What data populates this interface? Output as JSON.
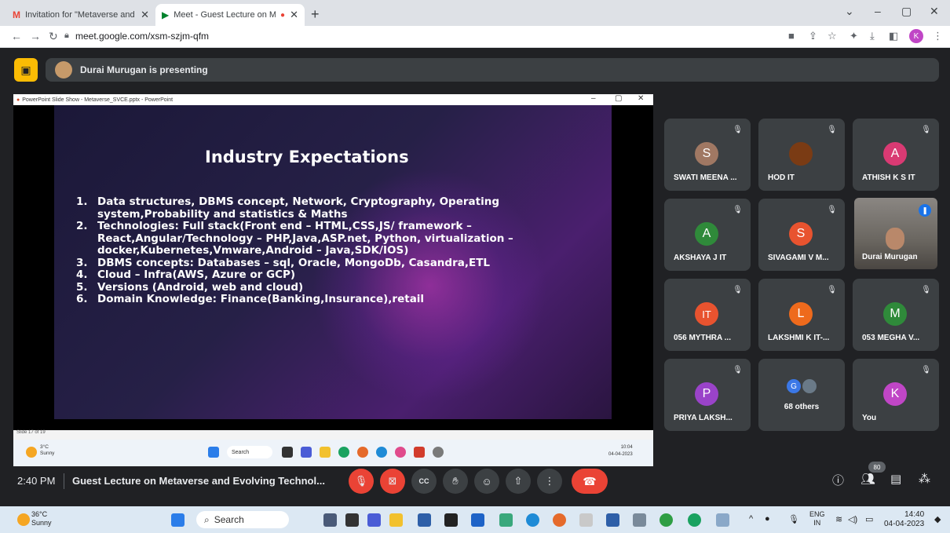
{
  "browser": {
    "tabs": [
      {
        "label": "Invitation for \"Metaverse and Evo"
      },
      {
        "label": "Meet - Guest Lecture on Me"
      }
    ],
    "url": "meet.google.com/xsm-szjm-qfm",
    "profile_initial": "K"
  },
  "meet": {
    "presenter_banner": "Durai Murugan is presenting",
    "time": "2:40 PM",
    "meeting_title": "Guest Lecture on Metaverse and Evolving Technol...",
    "participant_count": "80",
    "participants": [
      {
        "initial": "S",
        "name": "SWATI MEENA ...",
        "color": "#a07863"
      },
      {
        "initial": "",
        "name": "HOD IT",
        "color": "#7a3b14"
      },
      {
        "initial": "A",
        "name": "ATHISH K S IT",
        "color": "#d93a73"
      },
      {
        "initial": "A",
        "name": "AKSHAYA J IT",
        "color": "#2f8a3a"
      },
      {
        "initial": "S",
        "name": "SIVAGAMI V M...",
        "color": "#e8532f"
      },
      {
        "initial": "",
        "name": "Durai Murugan",
        "color": ""
      },
      {
        "initial": "IT",
        "name": "056 MYTHRA ...",
        "color": "#e8532f"
      },
      {
        "initial": "L",
        "name": "LAKSHMI K IT-...",
        "color": "#ee6a1c"
      },
      {
        "initial": "M",
        "name": "053 MEGHA V...",
        "color": "#2f8a3a"
      },
      {
        "initial": "P",
        "name": "PRIYA LAKSH...",
        "color": "#9a43c9"
      },
      {
        "initial": "G",
        "name": "68 others",
        "color": "#3b78e7"
      },
      {
        "initial": "K",
        "name": "You",
        "color": "#c046c6"
      }
    ]
  },
  "shared_window": {
    "title": "PowerPoint Slide Show - Metaverse_SVCE.pptx - PowerPoint",
    "slide_status": "Slide 17 of 19",
    "slide": {
      "heading": "Industry Expectations",
      "items": [
        {
          "num": "1.",
          "text": "Data structures, DBMS concept, Network, Cryptography, Operating system,Probability and statistics & Maths"
        },
        {
          "num": "2.",
          "text": "Technologies: Full stack(Front end – HTML,CSS,JS/ framework – React,Angular/Technology – PHP,Java,ASP.net, Python, virtualization – docker,Kubernetes,Vmware,Android – Java,SDK/IOS)"
        },
        {
          "num": "3.",
          "text": "DBMS concepts: Databases – sql, Oracle, MongoDb, Casandra,ETL"
        },
        {
          "num": "4.",
          "text": "Cloud – Infra(AWS, Azure or GCP)"
        },
        {
          "num": "5.",
          "text": "Versions (Android, web and cloud)"
        },
        {
          "num": "6.",
          "text": "Domain Knowledge: Finance(Banking,Insurance),retail"
        }
      ]
    },
    "taskbar": {
      "temp": "3°C",
      "condition": "Sunny",
      "search": "Search",
      "time": "10:04",
      "date": "04-04-2023"
    }
  },
  "taskbar": {
    "temp": "36°C",
    "condition": "Sunny",
    "search": "Search",
    "lang_top": "ENG",
    "lang_bottom": "IN",
    "time": "14:40",
    "date": "04-04-2023"
  }
}
